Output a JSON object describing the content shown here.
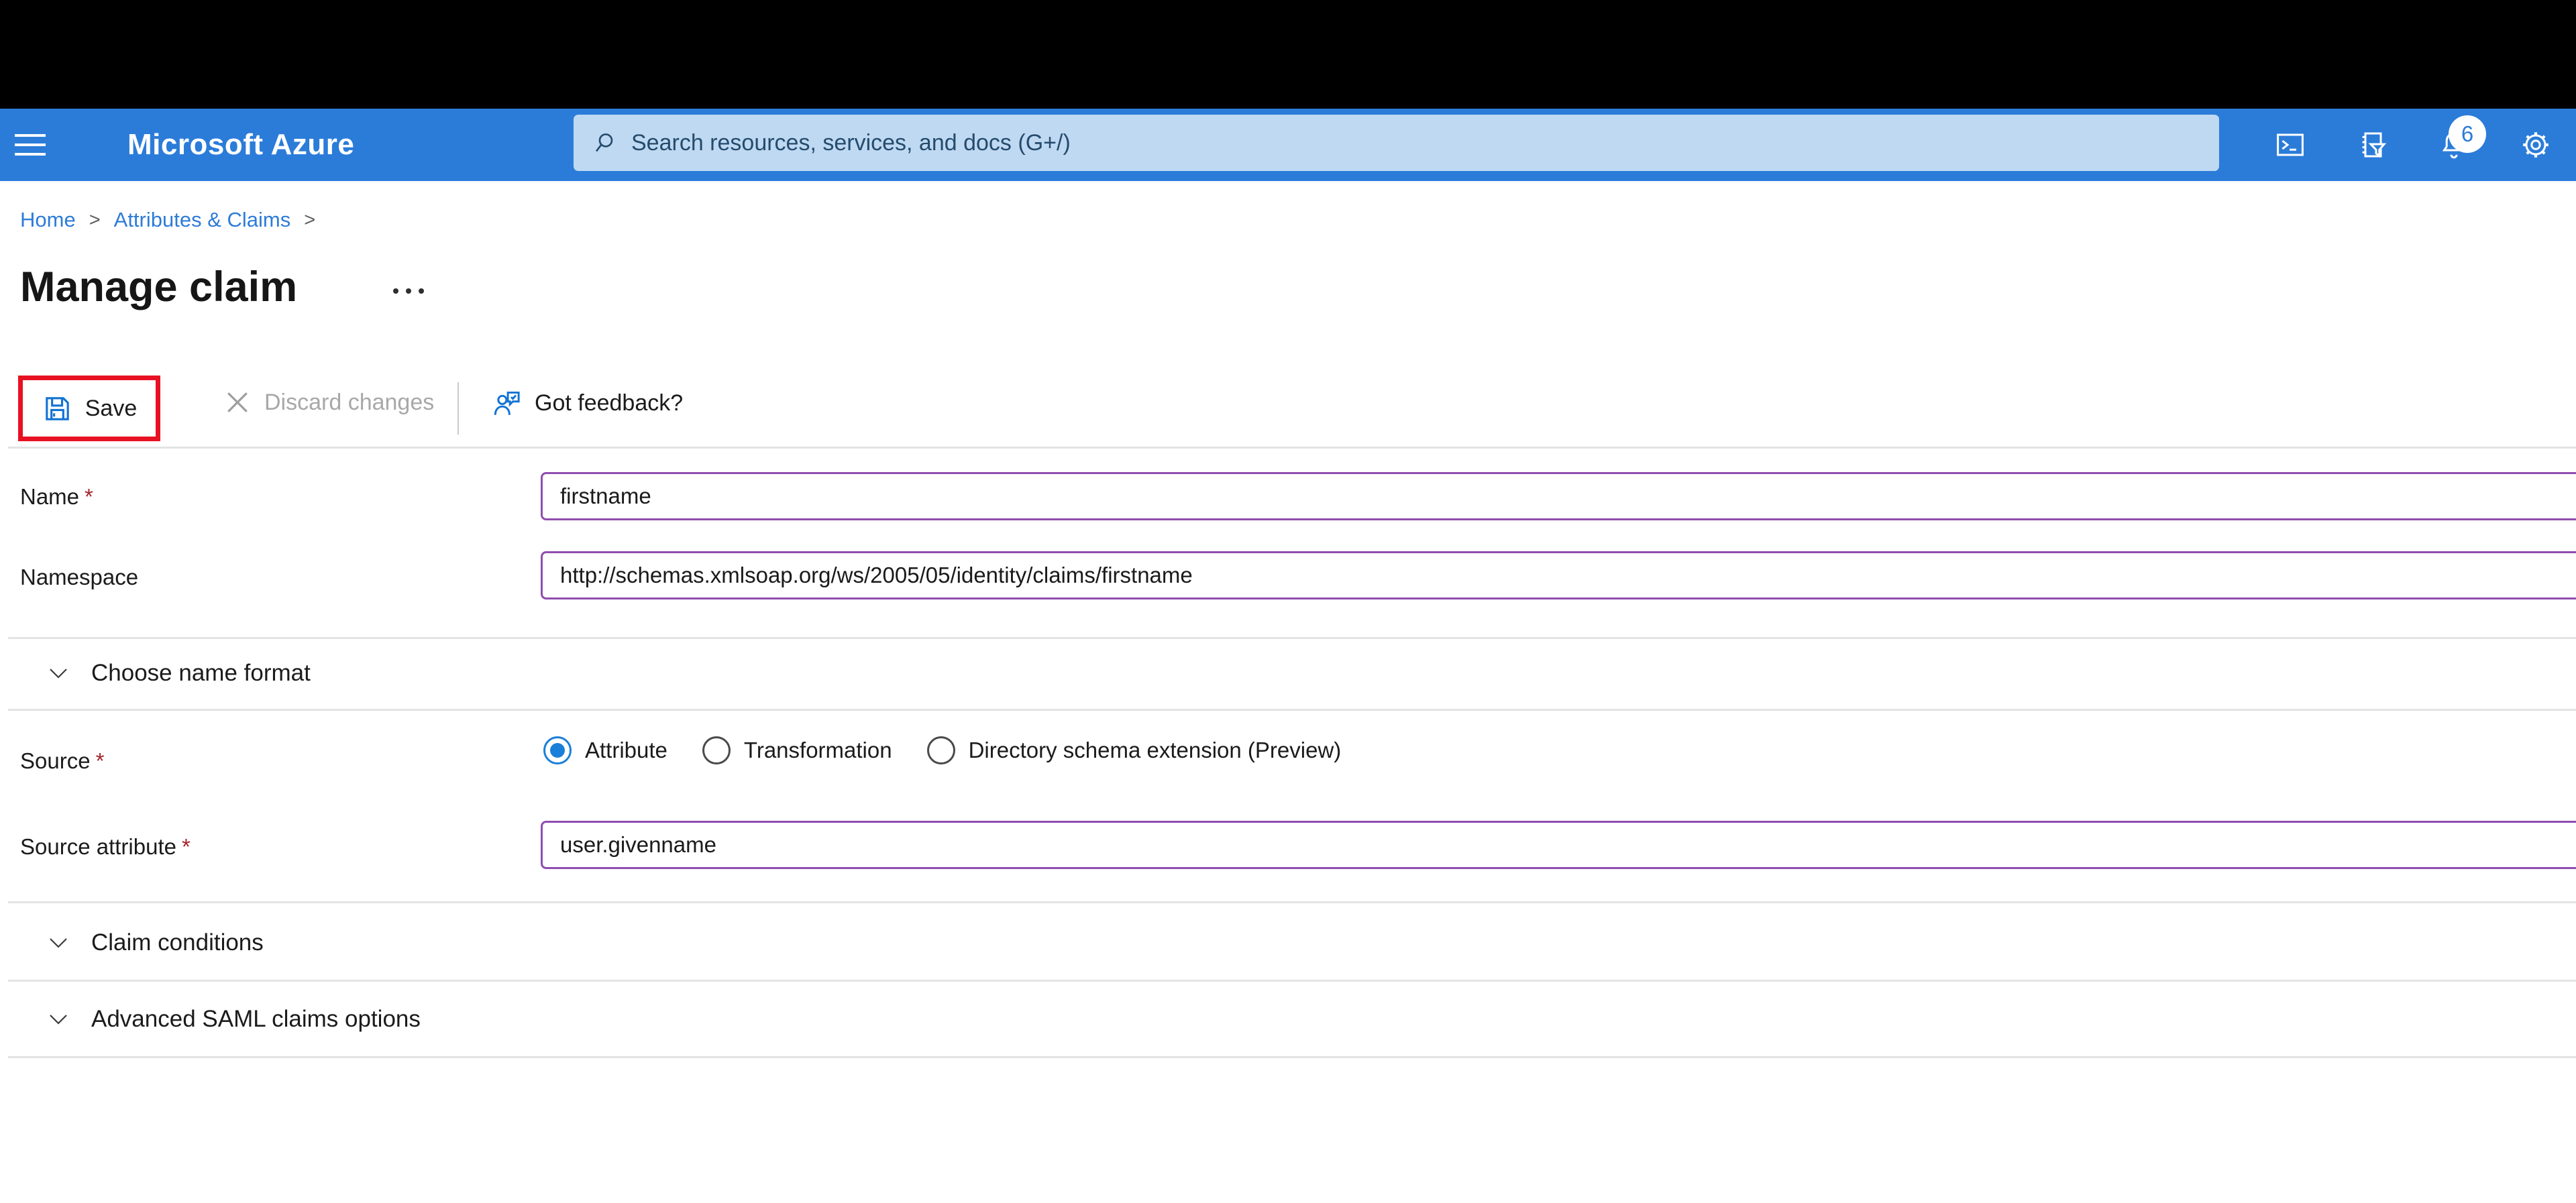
{
  "header": {
    "brand": "Microsoft Azure",
    "search_placeholder": "Search resources, services, and docs (G+/)",
    "notification_count": "6"
  },
  "breadcrumb": {
    "items": [
      "Home",
      "Attributes & Claims"
    ],
    "separator": ">"
  },
  "page": {
    "title": "Manage claim"
  },
  "toolbar": {
    "save_label": "Save",
    "discard_label": "Discard changes",
    "feedback_label": "Got feedback?"
  },
  "form": {
    "name": {
      "label": "Name",
      "required_mark": "*",
      "value": "firstname"
    },
    "namespace": {
      "label": "Namespace",
      "value": "http://schemas.xmlsoap.org/ws/2005/05/identity/claims/firstname"
    },
    "choose_name_format": {
      "label": "Choose name format"
    },
    "source": {
      "label": "Source",
      "required_mark": "*",
      "options": [
        {
          "label": "Attribute",
          "selected": true
        },
        {
          "label": "Transformation",
          "selected": false
        },
        {
          "label": "Directory schema extension (Preview)",
          "selected": false
        }
      ]
    },
    "source_attribute": {
      "label": "Source attribute",
      "required_mark": "*",
      "value": "user.givenname"
    },
    "claim_conditions": {
      "label": "Claim conditions"
    },
    "advanced_saml": {
      "label": "Advanced SAML claims options"
    }
  },
  "colors": {
    "header_blue": "#2b7cd9",
    "link_blue": "#2e7cd6",
    "input_border_purple": "#8f4daf",
    "annotation_red": "#e81123",
    "required_red": "#a4262c",
    "icon_blue": "#1273d4",
    "search_bg": "#bfd9f2",
    "search_text": "#254b6d"
  }
}
